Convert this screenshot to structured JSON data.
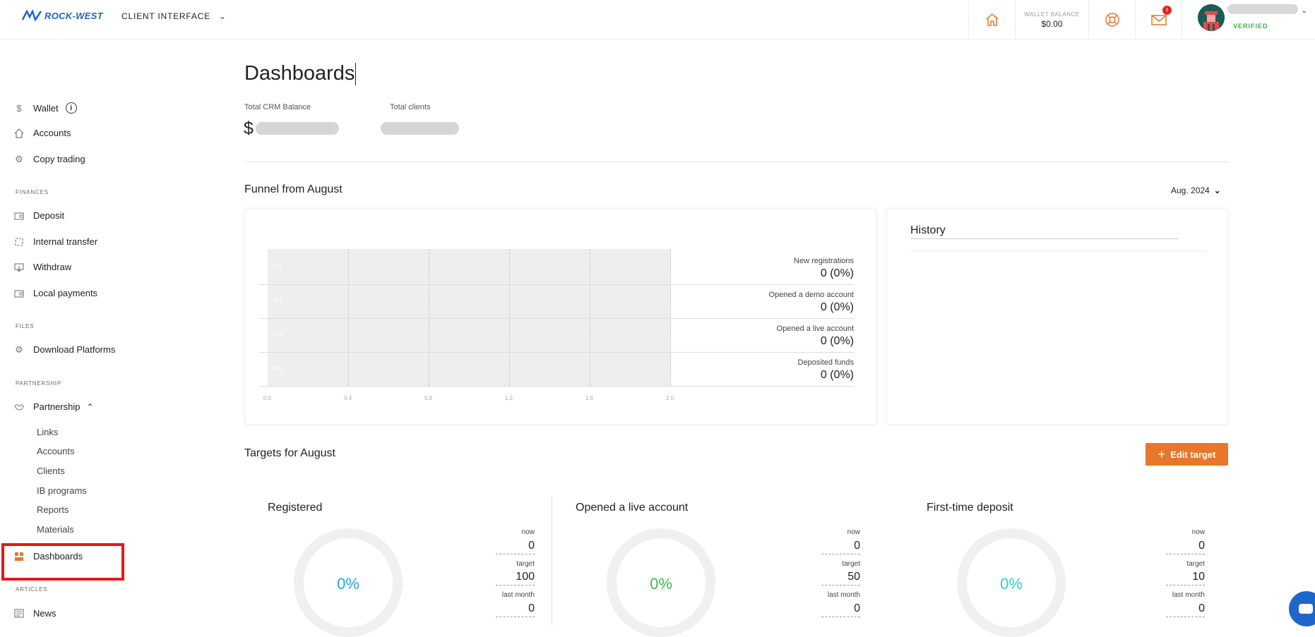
{
  "header": {
    "logo_text": "ROCK-WEST",
    "interface_label": "CLIENT INTERFACE",
    "wallet_balance_label": "WALLET BALANCE",
    "wallet_balance_value": "$0.00",
    "notifications_count": "1",
    "verified_label": "VERIFIED",
    "accent_color": "#e8762b",
    "brand_color": "#1e66c9"
  },
  "sidebar": {
    "top_items": [
      {
        "label": "Wallet",
        "icon": "dollar-icon"
      },
      {
        "label": "Accounts",
        "icon": "home-icon"
      },
      {
        "label": "Copy trading",
        "icon": "gear-icon"
      }
    ],
    "finances_label": "FINANCES",
    "finances_items": [
      {
        "label": "Deposit",
        "icon": "wallet-icon"
      },
      {
        "label": "Internal transfer",
        "icon": "transfer-icon"
      },
      {
        "label": "Withdraw",
        "icon": "withdraw-icon"
      },
      {
        "label": "Local payments",
        "icon": "wallet-icon"
      }
    ],
    "files_label": "FILES",
    "files_items": [
      {
        "label": "Download Platforms",
        "icon": "gear-icon"
      }
    ],
    "partnership_label": "PARTNERSHIP",
    "partnership_item": {
      "label": "Partnership",
      "icon": "handshake-icon"
    },
    "partnership_sub": [
      "Links",
      "Accounts",
      "Clients",
      "IB programs",
      "Reports",
      "Materials"
    ],
    "dashboards_item": {
      "label": "Dashboards",
      "icon": "dashboard-icon"
    },
    "articles_label": "ARTICLES",
    "articles_items": [
      {
        "label": "News",
        "icon": "news-icon"
      }
    ]
  },
  "main": {
    "title": "Dashboards",
    "total_crm_label": "Total CRM Balance",
    "total_crm_prefix": "$",
    "total_clients_label": "Total clients",
    "funnel_title": "Funnel from August",
    "period": "Aug. 2024",
    "history_title": "History",
    "funnel_rows": [
      {
        "label": "New registrations",
        "value": "0 (0%)",
        "bar_label": "0%"
      },
      {
        "label": "Opened a demo account",
        "value": "0 (0%)",
        "bar_label": "0%"
      },
      {
        "label": "Opened a live account",
        "value": "0 (0%)",
        "bar_label": "0%"
      },
      {
        "label": "Deposited funds",
        "value": "0 (0%)",
        "bar_label": "0%"
      }
    ],
    "x_ticks": [
      "0.0",
      "0.4",
      "0.8",
      "1.2",
      "1.6",
      "2.0"
    ],
    "targets_title": "Targets for August",
    "edit_target_label": "Edit target",
    "targets": [
      {
        "title": "Registered",
        "percent": "0%",
        "color": "#2aa3e0",
        "now_label": "now",
        "now": "0",
        "target_label": "target",
        "target": "100",
        "last_label": "last month",
        "last": "0"
      },
      {
        "title": "Opened a live account",
        "percent": "0%",
        "color": "#3db84a",
        "now_label": "now",
        "now": "0",
        "target_label": "target",
        "target": "50",
        "last_label": "last month",
        "last": "0"
      },
      {
        "title": "First-time deposit",
        "percent": "0%",
        "color": "#2fcfc4",
        "now_label": "now",
        "now": "0",
        "target_label": "target",
        "target": "10",
        "last_label": "last month",
        "last": "0"
      }
    ]
  }
}
